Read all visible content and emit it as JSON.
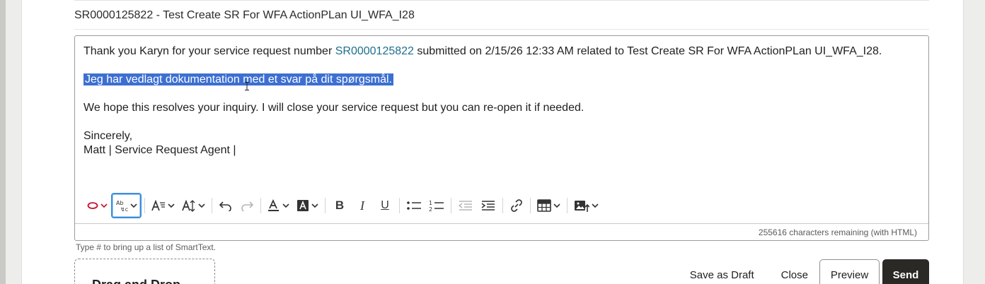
{
  "subject": "SR0000125822 - Test Create SR For WFA ActionPLan UI_WFA_I28",
  "message": {
    "line1_prefix": "Thank you Karyn for your service request number ",
    "line1_link": "SR0000125822",
    "line1_suffix": " submitted on 2/15/26 12:33 AM related to Test Create SR For WFA ActionPLan UI_WFA_I28.",
    "selected_line": "Jeg har vedlagt dokumentation med et svar på dit spørgsmål.",
    "line3": "We hope this resolves your inquiry. I will close your service request but you can re-open it if needed.",
    "closing": "Sincerely,",
    "signature": "Matt | Service Request Agent |"
  },
  "toolbar": {
    "icons": [
      "oval-shape-icon",
      "spellcheck-icon",
      "font-style-icon",
      "font-size-icon",
      "undo-icon",
      "redo-icon",
      "text-color-icon",
      "highlight-color-icon",
      "bold-icon",
      "italic-icon",
      "underline-icon",
      "bulleted-list-icon",
      "numbered-list-icon",
      "outdent-icon",
      "indent-icon",
      "link-icon",
      "table-icon",
      "insert-image-icon"
    ],
    "bold_glyph": "B",
    "italic_glyph": "I",
    "underline_glyph": "U",
    "accent_color": "#c8102e",
    "focus_color": "#3a8dde"
  },
  "char_count": "255616 characters remaining (with HTML)",
  "hint": "Type # to bring up a list of SmartText.",
  "dropzone_label": "Drag and Drop",
  "buttons": {
    "save_draft": "Save as Draft",
    "close": "Close",
    "preview": "Preview",
    "send": "Send"
  },
  "colors": {
    "selection": "#3c6fd1",
    "link": "#1d6f8e",
    "primary_button": "#2a2926"
  }
}
